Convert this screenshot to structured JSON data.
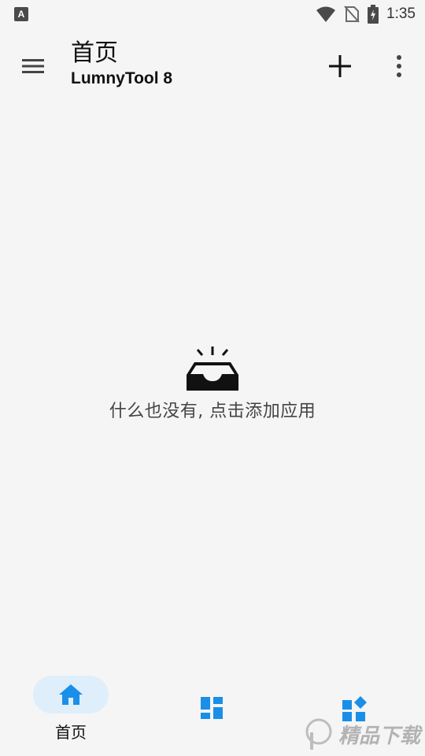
{
  "status_bar": {
    "time": "1:35",
    "left_icon_letter": "A"
  },
  "app_bar": {
    "title": "首页",
    "subtitle": "LumnyTool 8"
  },
  "empty_state": {
    "message": "什么也没有, 点击添加应用"
  },
  "bottom_nav": {
    "items": [
      {
        "label": "首页",
        "icon": "home-icon",
        "active": true
      },
      {
        "label": "",
        "icon": "dashboard-icon",
        "active": false
      },
      {
        "label": "",
        "icon": "apps-icon",
        "active": false
      }
    ]
  },
  "watermark": {
    "text": "精品下载"
  },
  "colors": {
    "accent": "#1a8fe8",
    "background": "#f5f5f5",
    "active_pill": "#dfeefb"
  }
}
